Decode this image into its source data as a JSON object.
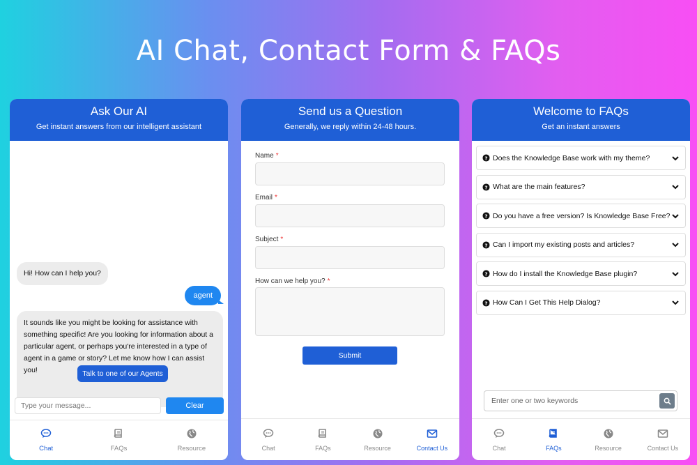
{
  "page_title": "AI Chat, Contact Form & FAQs",
  "chat": {
    "header_title": "Ask Our AI",
    "header_subtitle": "Get instant answers from our intelligent assistant",
    "messages": [
      {
        "from": "bot",
        "text": "Hi! How can I help you?"
      },
      {
        "from": "user",
        "text": "agent"
      },
      {
        "from": "bot",
        "text": "It sounds like you might be looking for assistance with something specific! Are you looking for information about a particular agent, or perhaps you're interested in a type of agent in a game or story? Let me know how I can assist you!"
      }
    ],
    "agents_button": "Talk to one of our Agents",
    "input_placeholder": "Type your message...",
    "clear_button": "Clear",
    "nav": [
      {
        "label": "Chat",
        "icon": "chat-icon",
        "active": true
      },
      {
        "label": "FAQs",
        "icon": "book-icon",
        "active": false
      },
      {
        "label": "Resource",
        "icon": "globe-icon",
        "active": false
      }
    ]
  },
  "contact": {
    "header_title": "Send us a Question",
    "header_subtitle": "Generally, we reply within 24-48 hours.",
    "fields": [
      {
        "label": "Name",
        "required_mark": "*"
      },
      {
        "label": "Email",
        "required_mark": "*"
      },
      {
        "label": "Subject",
        "required_mark": "*"
      },
      {
        "label": "How can we help you?",
        "required_mark": "*"
      }
    ],
    "submit_button": "Submit",
    "nav": [
      {
        "label": "Chat",
        "icon": "chat-icon",
        "active": false
      },
      {
        "label": "FAQs",
        "icon": "book-icon",
        "active": false
      },
      {
        "label": "Resource",
        "icon": "globe-icon",
        "active": false
      },
      {
        "label": "Contact Us",
        "icon": "mail-icon",
        "active": true
      }
    ]
  },
  "faqs": {
    "header_title": "Welcome to FAQs",
    "header_subtitle": "Get an instant answers",
    "items": [
      "Does the Knowledge Base work with my theme?",
      "What are the main features?",
      "Do you have a free version? Is Knowledge Base Free?",
      "Can I import my existing posts and articles?",
      "How do I install the Knowledge Base plugin?",
      "How Can I Get This Help Dialog?"
    ],
    "search_placeholder": "Enter one or two keywords",
    "nav": [
      {
        "label": "Chat",
        "icon": "chat-icon",
        "active": false
      },
      {
        "label": "FAQs",
        "icon": "book-icon",
        "active": true
      },
      {
        "label": "Resource",
        "icon": "globe-icon",
        "active": false
      },
      {
        "label": "Contact Us",
        "icon": "mail-icon",
        "active": false
      }
    ]
  },
  "colors": {
    "header_blue": "#1f5fd6",
    "user_bubble": "#1f87f0",
    "required": "#e33333"
  }
}
